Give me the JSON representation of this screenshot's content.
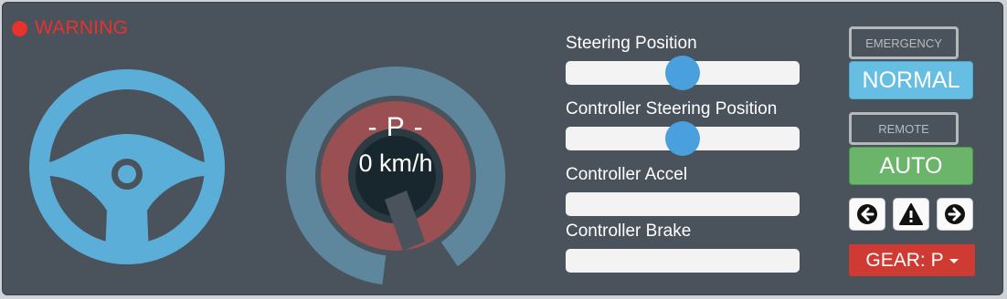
{
  "status": {
    "warning_label": "WARNING",
    "color": "#e8322b"
  },
  "steering_wheel": {
    "icon": "steering-wheel-icon",
    "color": "#5aaed8"
  },
  "speedometer": {
    "gear_text": "- P -",
    "speed_text": "0 km/h",
    "colors": {
      "outer_ring": "#5e879e",
      "inner_fill": "#9a4f52",
      "center": "#18272e"
    }
  },
  "sliders": [
    {
      "label": "Steering Position",
      "value": 0.5,
      "has_knob": true
    },
    {
      "label": "Controller Steering Position",
      "value": 0.5,
      "has_knob": true
    },
    {
      "label": "Controller Accel",
      "value": 0,
      "has_knob": false
    },
    {
      "label": "Controller Brake",
      "value": 0,
      "has_knob": false
    }
  ],
  "modes": {
    "emergency_label": "EMERGENCY",
    "normal_label": "NORMAL",
    "remote_label": "REMOTE",
    "auto_label": "AUTO"
  },
  "signals": {
    "left": "arrow-left-circle-icon",
    "hazard": "warning-triangle-icon",
    "right": "arrow-right-circle-icon"
  },
  "gear_dropdown": {
    "label": "GEAR: P"
  }
}
